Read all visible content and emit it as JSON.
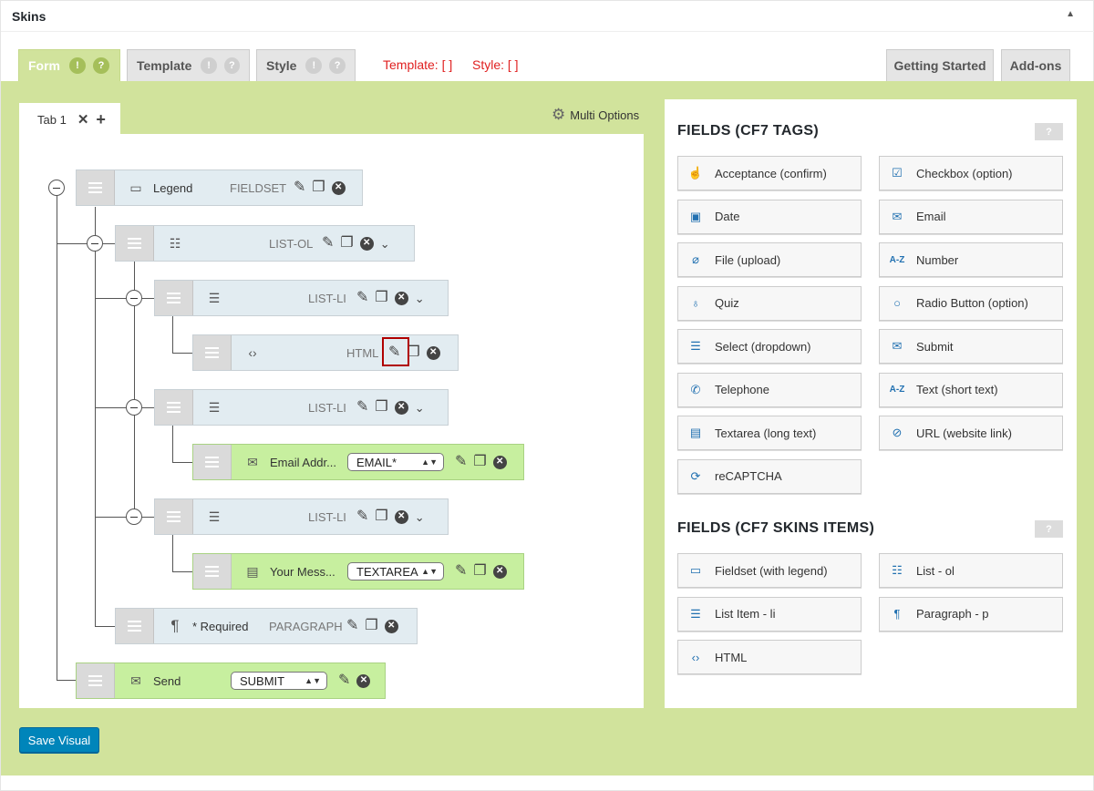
{
  "panel": {
    "title": "Skins",
    "collapse_icon": "triangle-up-icon"
  },
  "top_tabs": [
    {
      "label": "Form",
      "badge1": "!",
      "badge2": "?"
    },
    {
      "label": "Template",
      "badge1": "!",
      "badge2": "?"
    },
    {
      "label": "Style",
      "badge1": "!",
      "badge2": "?"
    }
  ],
  "status_text": {
    "template": "Template: [  ]",
    "style": "Style: [  ]"
  },
  "right_tabs": {
    "getting_started": "Getting Started",
    "addons": "Add-ons"
  },
  "inner_tab": {
    "label": "Tab 1",
    "close": "✕",
    "add": "+"
  },
  "multi_options": "Multi Options",
  "tree": [
    {
      "label": "Legend",
      "type": "FIELDSET",
      "icon": "folder-icon"
    },
    {
      "label": "",
      "type": "LIST-OL",
      "icon": "ordered-list-icon"
    },
    {
      "label": "",
      "type": "LIST-LI",
      "icon": "list-icon"
    },
    {
      "label": "",
      "type": "HTML",
      "icon": "code-icon"
    },
    {
      "label": "",
      "type": "LIST-LI",
      "icon": "list-icon"
    },
    {
      "label": "Email Addr...",
      "type": "",
      "select": "EMAIL*",
      "icon": "envelope-icon"
    },
    {
      "label": "",
      "type": "LIST-LI",
      "icon": "list-icon"
    },
    {
      "label": "Your Mess...",
      "type": "",
      "select": "TEXTAREA",
      "icon": "textarea-icon"
    },
    {
      "label": "* Required",
      "type": "PARAGRAPH",
      "icon": "paragraph-icon"
    },
    {
      "label": "Send",
      "type": "",
      "select": "SUBMIT",
      "icon": "envelope-icon"
    }
  ],
  "fields_cf7": {
    "heading": "FIELDS (CF7 TAGS)",
    "help": "?",
    "items": [
      {
        "label": "Acceptance (confirm)",
        "icon": "hand-icon",
        "glyph": "☝"
      },
      {
        "label": "Checkbox (option)",
        "icon": "checkbox-icon",
        "glyph": "☑"
      },
      {
        "label": "Date",
        "icon": "calendar-icon",
        "glyph": "▣"
      },
      {
        "label": "Email",
        "icon": "envelope-icon",
        "glyph": "✉"
      },
      {
        "label": "File (upload)",
        "icon": "paperclip-icon",
        "glyph": "⌀"
      },
      {
        "label": "Number",
        "icon": "a-z-icon",
        "glyph": "A-Z"
      },
      {
        "label": "Quiz",
        "icon": "lightbulb-icon",
        "glyph": "♁"
      },
      {
        "label": "Radio Button (option)",
        "icon": "radio-icon",
        "glyph": "○"
      },
      {
        "label": "Select (dropdown)",
        "icon": "menu-icon",
        "glyph": "☰"
      },
      {
        "label": "Submit",
        "icon": "envelope-icon",
        "glyph": "✉"
      },
      {
        "label": "Telephone",
        "icon": "phone-icon",
        "glyph": "✆"
      },
      {
        "label": "Text (short text)",
        "icon": "a-z-icon",
        "glyph": "A-Z"
      },
      {
        "label": "Textarea (long text)",
        "icon": "document-icon",
        "glyph": "▤"
      },
      {
        "label": "URL (website link)",
        "icon": "link-icon",
        "glyph": "⊘"
      },
      {
        "label": "reCAPTCHA",
        "icon": "refresh-icon",
        "glyph": "⟳"
      }
    ]
  },
  "fields_skins": {
    "heading": "FIELDS (CF7 SKINS ITEMS)",
    "help": "?",
    "items": [
      {
        "label": "Fieldset (with legend)",
        "icon": "folder-icon",
        "glyph": "▭"
      },
      {
        "label": "List - ol",
        "icon": "ordered-list-icon",
        "glyph": "☷"
      },
      {
        "label": "List Item - li",
        "icon": "list-icon",
        "glyph": "☰"
      },
      {
        "label": "Paragraph - p",
        "icon": "paragraph-icon",
        "glyph": "¶"
      },
      {
        "label": "HTML",
        "icon": "code-icon",
        "glyph": "‹›"
      }
    ]
  },
  "save_button": "Save Visual"
}
